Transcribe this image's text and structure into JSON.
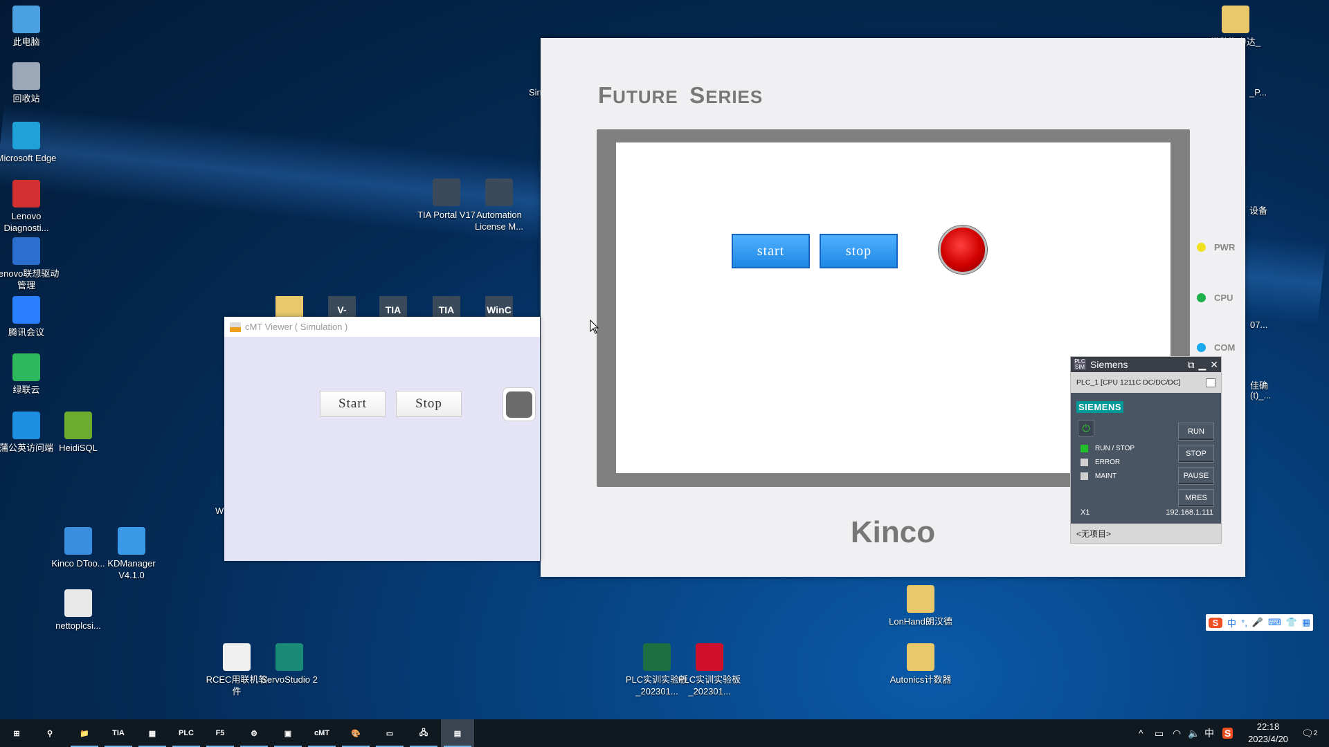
{
  "desktop": {
    "icons": [
      {
        "label": "此电脑",
        "icon": "computer-icon",
        "color": "#4aa0e0"
      },
      {
        "label": "回收站",
        "icon": "recycle-bin-icon",
        "color": "#9aa8b8"
      },
      {
        "label": "Microsoft Edge",
        "icon": "edge-icon",
        "color": "#1fa2d8"
      },
      {
        "label": "Lenovo Diagnosti...",
        "icon": "lenovo-diagnostics-icon",
        "color": "#d03030"
      },
      {
        "label": "Lenovo联想驱动管理",
        "icon": "lenovo-driver-icon",
        "color": "#2a6fd0"
      },
      {
        "label": "腾讯会议",
        "icon": "tencent-meeting-icon",
        "color": "#2a7fff"
      },
      {
        "label": "绿联云",
        "icon": "ugreen-cloud-icon",
        "color": "#2eb85c"
      },
      {
        "label": "蒲公英访问端",
        "icon": "pgy-icon",
        "color": "#1e8fe0"
      },
      {
        "label": "HeidiSQL",
        "icon": "heidisql-icon",
        "color": "#6bab2e"
      },
      {
        "label": "TIA Portal V17",
        "icon": "tia-portal-icon",
        "color": "#3a4a5a"
      },
      {
        "label": "Automation License M...",
        "icon": "license-manager-icon",
        "color": "#3a4a5a"
      },
      {
        "label": "Kinco DToo...",
        "icon": "kinco-dtools-icon",
        "color": "#3a8ee0"
      },
      {
        "label": "KDManager V4.1.0",
        "icon": "kdmanager-icon",
        "color": "#3a9ae8"
      },
      {
        "label": "nettoplcsi...",
        "icon": "file-icon",
        "color": "#e8e8e8"
      },
      {
        "label": "RCEC用联机软件",
        "icon": "rcec-icon",
        "color": "#f0f0f0"
      },
      {
        "label": "ServoStudio 2",
        "icon": "servostudio-icon",
        "color": "#1a8a78"
      },
      {
        "label": "PLC实训实验板_202301...",
        "icon": "excel-icon",
        "color": "#1d6f42"
      },
      {
        "label": "PLC实训实验板_202301...",
        "icon": "pdf-icon",
        "color": "#d0102a"
      },
      {
        "label": "LonHand朗汉德",
        "icon": "folder-icon",
        "color": "#e8c86a"
      },
      {
        "label": "Autonics计数器",
        "icon": "folder-icon",
        "color": "#e8c86a"
      },
      {
        "label": "常熟海力达_",
        "icon": "archive-folder-icon",
        "color": "#e8c86a"
      }
    ],
    "partial_icons": [
      {
        "glyph": "",
        "icon": "folder-icon",
        "color": "#e8c86a"
      },
      {
        "glyph": "V-",
        "icon": "v-app-icon",
        "color": "#3a4a5a"
      },
      {
        "glyph": "TIA",
        "icon": "tia-min-icon",
        "color": "#3a4a5a"
      },
      {
        "glyph": "TIA",
        "icon": "tia-icon",
        "color": "#3a4a5a"
      },
      {
        "glyph": "WinC",
        "icon": "wincc-icon",
        "color": "#3a4a5a"
      }
    ],
    "partial_labels": [
      "Sin",
      "W",
      "_P...",
      "设备",
      "07...",
      "佳确",
      "(t)_..."
    ]
  },
  "kinco_window": {
    "series_title_first": "F",
    "series_title_rest": "UTURE",
    "series_title_s": "S",
    "series_title_rest2": "ERIES",
    "start_label": "start",
    "stop_label": "stop",
    "lamp_state": "on",
    "lamp_color": "#e00000",
    "leds": [
      {
        "label": "PWR",
        "color": "#f0e020"
      },
      {
        "label": "CPU",
        "color": "#1db04c"
      },
      {
        "label": "COM",
        "color": "#1aa8ee"
      }
    ],
    "brand": "Kinco"
  },
  "cmt_viewer": {
    "title": "cMT Viewer ( Simulation )",
    "start_label": "Start",
    "stop_label": "Stop",
    "lamp_state": "off"
  },
  "plcsim": {
    "title": "Siemens",
    "title_icon": "PLC SIM",
    "plc": "PLC_1 [CPU 1211C DC/DC/DC]",
    "brand": "SIEMENS",
    "leds": [
      {
        "label": "RUN / STOP",
        "color": "#22c02a"
      },
      {
        "label": "ERROR",
        "color": "#d0d0d0"
      },
      {
        "label": "MAINT",
        "color": "#d0d0d0"
      }
    ],
    "buttons": [
      "RUN",
      "STOP",
      "PAUSE",
      "MRES"
    ],
    "interface": "X1",
    "ip": "192.168.1.111",
    "project": "<无项目>"
  },
  "taskbar": {
    "items": [
      {
        "icon": "start-windows-icon",
        "glyph": "⊞"
      },
      {
        "icon": "search-icon",
        "glyph": "⚲"
      },
      {
        "icon": "file-explorer-icon",
        "glyph": "📁"
      },
      {
        "icon": "tia-v17-icon",
        "glyph": "TIA"
      },
      {
        "icon": "network-tool-icon",
        "glyph": "▦"
      },
      {
        "icon": "plcsim-icon",
        "glyph": "PLC"
      },
      {
        "icon": "f5-icon",
        "glyph": "F5"
      },
      {
        "icon": "kinco-icon",
        "glyph": "⚙"
      },
      {
        "icon": "hmi-icon",
        "glyph": "▣"
      },
      {
        "icon": "cmt-viewer-icon",
        "glyph": "cMT"
      },
      {
        "icon": "paint-icon",
        "glyph": "🎨"
      },
      {
        "icon": "camera-icon",
        "glyph": "▭"
      },
      {
        "icon": "network-config-icon",
        "glyph": "🖧"
      },
      {
        "icon": "simulator-icon",
        "glyph": "▤"
      }
    ],
    "time": "22:18",
    "date": "2023/4/20",
    "ime_lang": "中",
    "notifications": "2"
  },
  "ime_toolbar": {
    "lang": "中",
    "items": [
      "°,",
      "🎤",
      "⌨",
      "👕",
      "▦"
    ]
  }
}
